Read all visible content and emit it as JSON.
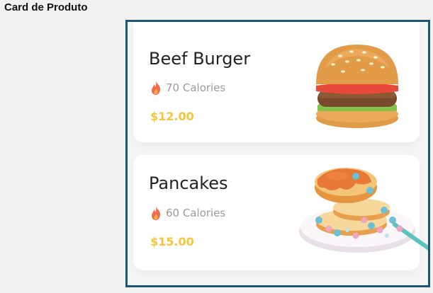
{
  "page_title": "Card de Produto",
  "colors": {
    "frame": "#1e5570",
    "price": "#f8c43a",
    "flame": "#f36a4a",
    "muted": "#9a9a9a"
  },
  "products": [
    {
      "name": "Beef Burger",
      "calories": "70 Calories",
      "price": "$12.00",
      "image_icon": "burger-icon"
    },
    {
      "name": "Pancakes",
      "calories": "60 Calories",
      "price": "$15.00",
      "image_icon": "pancakes-icon"
    }
  ]
}
